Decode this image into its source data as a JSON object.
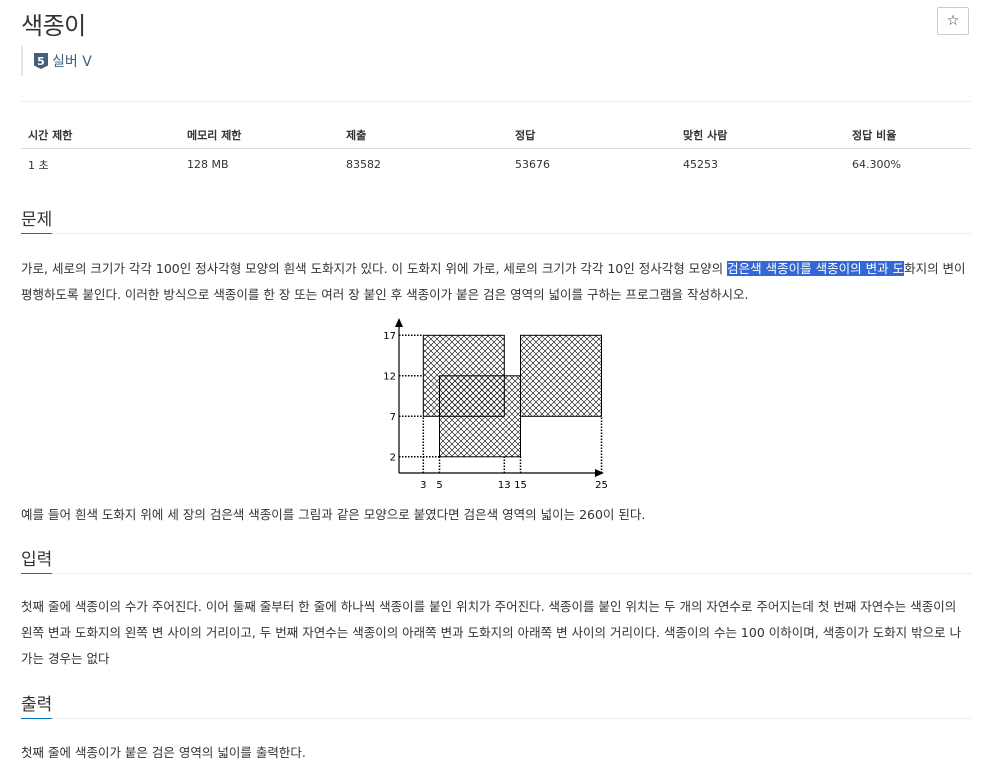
{
  "problem": {
    "title": "색종이"
  },
  "tier": {
    "level": "5",
    "label": "실버 V"
  },
  "star_icon": "☆",
  "info_table": {
    "headers": [
      "시간 제한",
      "메모리 제한",
      "제출",
      "정답",
      "맞힌 사람",
      "정답 비율"
    ],
    "values": [
      "1 초",
      "128 MB",
      "83582",
      "53676",
      "45253",
      "64.300%"
    ]
  },
  "sections": {
    "problem": {
      "heading": "문제",
      "p1_a": "가로, 세로의 크기가 각각 100인 정사각형 모양의 흰색 도화지가 있다. 이 도화지 위에 가로, 세로의 크기가 각각 10인 정사각형 모양의 ",
      "p1_highlight": "검은색 색종이를 색종이의 변과 도",
      "p1_b": "화지의 변이 평행하도록 붙인다. 이러한 방식으로 색종이를 한 장 또는 여러 장 붙인 후 색종이가 붙은 검은 영역의 넓이를 구하는 프로그램을 작성하시오.",
      "p2": "예를 들어 흰색 도화지 위에 세 장의 검은색 색종이를 그림과 같은 모양으로 붙였다면 검은색 영역의 넓이는 260이 된다."
    },
    "input": {
      "heading": "입력",
      "text": "첫째 줄에 색종이의 수가 주어진다. 이어 둘째 줄부터 한 줄에 하나씩 색종이를 붙인 위치가 주어진다. 색종이를 붙인 위치는 두 개의 자연수로 주어지는데 첫 번째 자연수는 색종이의 왼쪽 변과 도화지의 왼쪽 변 사이의 거리이고, 두 번째 자연수는 색종이의 아래쪽 변과 도화지의 아래쪽 변 사이의 거리이다. 색종이의 수는 100 이하이며, 색종이가 도화지 밖으로 나가는 경우는 없다"
    },
    "output": {
      "heading": "출력",
      "text": "첫째 줄에 색종이가 붙은 검은 영역의 넓이를 출력한다."
    }
  },
  "figure": {
    "x_ticks": [
      "3",
      "5",
      "13",
      "15",
      "25"
    ],
    "y_ticks": [
      "17",
      "12",
      "7",
      "2"
    ]
  }
}
